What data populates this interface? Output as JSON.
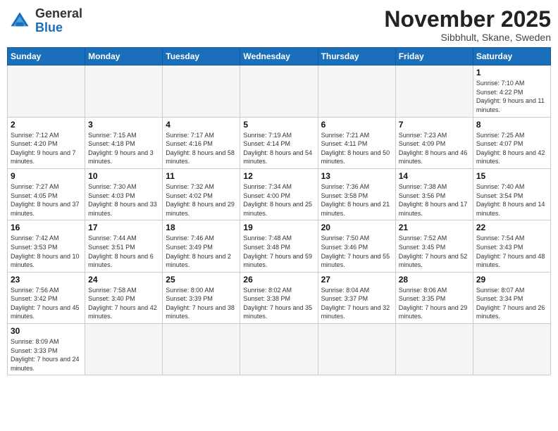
{
  "logo": {
    "general": "General",
    "blue": "Blue"
  },
  "title": "November 2025",
  "subtitle": "Sibbhult, Skane, Sweden",
  "days_of_week": [
    "Sunday",
    "Monday",
    "Tuesday",
    "Wednesday",
    "Thursday",
    "Friday",
    "Saturday"
  ],
  "weeks": [
    [
      {
        "day": "",
        "info": "",
        "empty": true
      },
      {
        "day": "",
        "info": "",
        "empty": true
      },
      {
        "day": "",
        "info": "",
        "empty": true
      },
      {
        "day": "",
        "info": "",
        "empty": true
      },
      {
        "day": "",
        "info": "",
        "empty": true
      },
      {
        "day": "",
        "info": "",
        "empty": true
      },
      {
        "day": "1",
        "info": "Sunrise: 7:10 AM\nSunset: 4:22 PM\nDaylight: 9 hours\nand 11 minutes."
      }
    ],
    [
      {
        "day": "2",
        "info": "Sunrise: 7:12 AM\nSunset: 4:20 PM\nDaylight: 9 hours\nand 7 minutes."
      },
      {
        "day": "3",
        "info": "Sunrise: 7:15 AM\nSunset: 4:18 PM\nDaylight: 9 hours\nand 3 minutes."
      },
      {
        "day": "4",
        "info": "Sunrise: 7:17 AM\nSunset: 4:16 PM\nDaylight: 8 hours\nand 58 minutes."
      },
      {
        "day": "5",
        "info": "Sunrise: 7:19 AM\nSunset: 4:14 PM\nDaylight: 8 hours\nand 54 minutes."
      },
      {
        "day": "6",
        "info": "Sunrise: 7:21 AM\nSunset: 4:11 PM\nDaylight: 8 hours\nand 50 minutes."
      },
      {
        "day": "7",
        "info": "Sunrise: 7:23 AM\nSunset: 4:09 PM\nDaylight: 8 hours\nand 46 minutes."
      },
      {
        "day": "8",
        "info": "Sunrise: 7:25 AM\nSunset: 4:07 PM\nDaylight: 8 hours\nand 42 minutes."
      }
    ],
    [
      {
        "day": "9",
        "info": "Sunrise: 7:27 AM\nSunset: 4:05 PM\nDaylight: 8 hours\nand 37 minutes."
      },
      {
        "day": "10",
        "info": "Sunrise: 7:30 AM\nSunset: 4:03 PM\nDaylight: 8 hours\nand 33 minutes."
      },
      {
        "day": "11",
        "info": "Sunrise: 7:32 AM\nSunset: 4:02 PM\nDaylight: 8 hours\nand 29 minutes."
      },
      {
        "day": "12",
        "info": "Sunrise: 7:34 AM\nSunset: 4:00 PM\nDaylight: 8 hours\nand 25 minutes."
      },
      {
        "day": "13",
        "info": "Sunrise: 7:36 AM\nSunset: 3:58 PM\nDaylight: 8 hours\nand 21 minutes."
      },
      {
        "day": "14",
        "info": "Sunrise: 7:38 AM\nSunset: 3:56 PM\nDaylight: 8 hours\nand 17 minutes."
      },
      {
        "day": "15",
        "info": "Sunrise: 7:40 AM\nSunset: 3:54 PM\nDaylight: 8 hours\nand 14 minutes."
      }
    ],
    [
      {
        "day": "16",
        "info": "Sunrise: 7:42 AM\nSunset: 3:53 PM\nDaylight: 8 hours\nand 10 minutes."
      },
      {
        "day": "17",
        "info": "Sunrise: 7:44 AM\nSunset: 3:51 PM\nDaylight: 8 hours\nand 6 minutes."
      },
      {
        "day": "18",
        "info": "Sunrise: 7:46 AM\nSunset: 3:49 PM\nDaylight: 8 hours\nand 2 minutes."
      },
      {
        "day": "19",
        "info": "Sunrise: 7:48 AM\nSunset: 3:48 PM\nDaylight: 7 hours\nand 59 minutes."
      },
      {
        "day": "20",
        "info": "Sunrise: 7:50 AM\nSunset: 3:46 PM\nDaylight: 7 hours\nand 55 minutes."
      },
      {
        "day": "21",
        "info": "Sunrise: 7:52 AM\nSunset: 3:45 PM\nDaylight: 7 hours\nand 52 minutes."
      },
      {
        "day": "22",
        "info": "Sunrise: 7:54 AM\nSunset: 3:43 PM\nDaylight: 7 hours\nand 48 minutes."
      }
    ],
    [
      {
        "day": "23",
        "info": "Sunrise: 7:56 AM\nSunset: 3:42 PM\nDaylight: 7 hours\nand 45 minutes."
      },
      {
        "day": "24",
        "info": "Sunrise: 7:58 AM\nSunset: 3:40 PM\nDaylight: 7 hours\nand 42 minutes."
      },
      {
        "day": "25",
        "info": "Sunrise: 8:00 AM\nSunset: 3:39 PM\nDaylight: 7 hours\nand 38 minutes."
      },
      {
        "day": "26",
        "info": "Sunrise: 8:02 AM\nSunset: 3:38 PM\nDaylight: 7 hours\nand 35 minutes."
      },
      {
        "day": "27",
        "info": "Sunrise: 8:04 AM\nSunset: 3:37 PM\nDaylight: 7 hours\nand 32 minutes."
      },
      {
        "day": "28",
        "info": "Sunrise: 8:06 AM\nSunset: 3:35 PM\nDaylight: 7 hours\nand 29 minutes."
      },
      {
        "day": "29",
        "info": "Sunrise: 8:07 AM\nSunset: 3:34 PM\nDaylight: 7 hours\nand 26 minutes."
      }
    ],
    [
      {
        "day": "30",
        "info": "Sunrise: 8:09 AM\nSunset: 3:33 PM\nDaylight: 7 hours\nand 24 minutes."
      },
      {
        "day": "",
        "info": "",
        "empty": true
      },
      {
        "day": "",
        "info": "",
        "empty": true
      },
      {
        "day": "",
        "info": "",
        "empty": true
      },
      {
        "day": "",
        "info": "",
        "empty": true
      },
      {
        "day": "",
        "info": "",
        "empty": true
      },
      {
        "day": "",
        "info": "",
        "empty": true
      }
    ]
  ]
}
